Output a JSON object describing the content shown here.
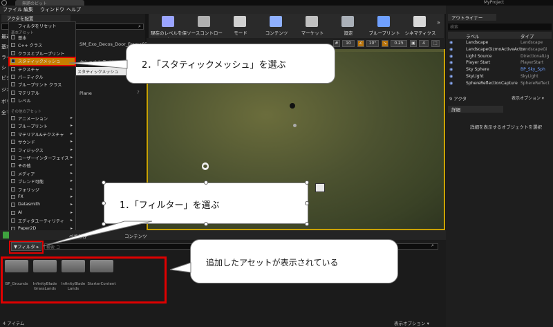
{
  "window": {
    "tab_title": "無題のビット",
    "project_name": "MyProject"
  },
  "menu": [
    "ファイル",
    "編集",
    "ウィンドウ",
    "ヘルプ"
  ],
  "place_mode": {
    "header": "アクタを配置",
    "search_placeholder": ""
  },
  "mode_rows": [
    "最近",
    "基本",
    "ライ",
    "シ",
    "ビジ",
    "ジオ",
    "ボリ",
    "全て"
  ],
  "filter_menu": {
    "reset": "フィルタをリセット",
    "section_basic": "基本アセット",
    "basic": [
      "基本",
      "C++ クラス",
      "クラスとブループリント",
      "スタティックメッシュ",
      "テクスチャ",
      "パーティクル",
      "ブループリント クラス",
      "マテリアル",
      "レベル"
    ],
    "section_other": "その他のアセット",
    "other": [
      "アニメーション",
      "ブループリント",
      "マテリアル&テクスチャ",
      "サウンド",
      "フィジックス",
      "ユーザーインターフェイス",
      "その他",
      "メディア",
      "ブレンド可能",
      "フォリッジ",
      "FX",
      "Datasmith",
      "AI",
      "エディタユーティリティ",
      "Paper2D",
      "その他のフィルタ"
    ],
    "selected": "スタティックメッシュ",
    "texture_more": "テクスチャ ▸"
  },
  "left_assets": {
    "item1": "SM_Exo_Decos_Door_Frame03",
    "item2": "クショナルライト",
    "input_text": "スタティックメッシュ",
    "item3": "Plane"
  },
  "toolbar": [
    {
      "label": "現在のレベルを保存",
      "icon": "save-icon",
      "color": "#9aa4ff"
    },
    {
      "label": "ソースコントロール",
      "icon": "source-control-icon",
      "color": "#b0b0b0"
    },
    {
      "label": "モード",
      "icon": "modes-icon",
      "color": "#d0d0d0"
    },
    {
      "label": "コンテンツ",
      "icon": "content-icon",
      "color": "#8fb0ff"
    },
    {
      "label": "マーケット",
      "icon": "marketplace-icon",
      "color": "#c0c0c0"
    },
    {
      "label": "設定",
      "icon": "settings-icon",
      "color": "#aab0b8"
    },
    {
      "label": "ブループリント",
      "icon": "blueprint-icon",
      "color": "#6fa0ff"
    },
    {
      "label": "シネマティクス",
      "icon": "cinematics-icon",
      "color": "#d8d8d8"
    }
  ],
  "viewport_controls": {
    "grid_snap": "10",
    "rotation_snap": "10°",
    "scale_snap": "0.25",
    "camera_speed": "4"
  },
  "outliner": {
    "tab": "アウトライナー",
    "search_placeholder": "検索",
    "col_label": "ラベル",
    "col_type": "タイプ",
    "rows": [
      {
        "name": "Landscape",
        "type": "Landscape"
      },
      {
        "name": "LandscapeGizmoActiveActor",
        "type": "LandscapeGi"
      },
      {
        "name": "Light Source",
        "type": "DirectionalLig"
      },
      {
        "name": "Player Start",
        "type": "PlayerStart"
      },
      {
        "name": "Sky Sphere",
        "type": "BP_Sky_Sph"
      },
      {
        "name": "SkyLight",
        "type": "SkyLight"
      },
      {
        "name": "SphereReflectionCapture",
        "type": "SphereReflect"
      }
    ],
    "count": "9 アクタ",
    "view_options": "表示オプション ▾"
  },
  "details": {
    "tab": "詳細",
    "empty_text": "詳細を表示するオブジェクトを選択"
  },
  "content_browser": {
    "save_all": "べて保存",
    "path": "コンテンツ",
    "filter_label": "▼フィルタ ▸",
    "search_placeholder": "検索 コ",
    "folders": [
      "BP_Grounds",
      "InfinityBlade GrassLands",
      "InfinityBlade Lands",
      "StarterContent"
    ],
    "item_count": "4 アイテム",
    "view_options": "表示オプション ▾"
  },
  "callouts": {
    "step1": "1．「フィルター」を選ぶ",
    "step2": "2．「スタティックメッシュ」を選ぶ",
    "note": "追加したアセットが表示されている"
  },
  "colors": {
    "highlight_red": "#e00000",
    "selected_orange": "#c87e00",
    "viewport_border": "#c9a100"
  }
}
